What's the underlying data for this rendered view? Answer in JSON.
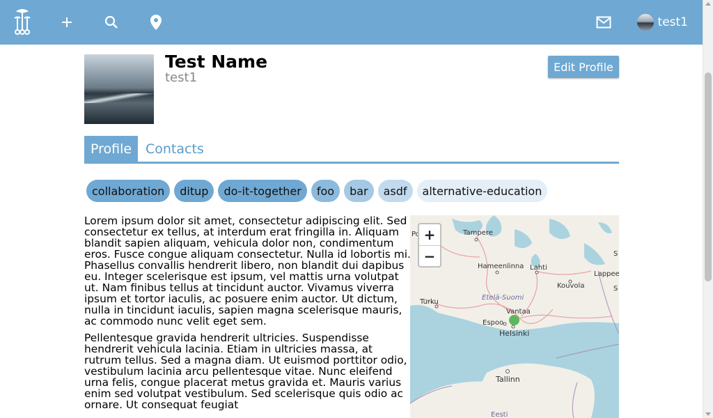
{
  "topbar": {
    "icons": [
      "mushroom-logo-icon",
      "plus-icon",
      "search-icon",
      "location-pin-icon",
      "mail-icon"
    ],
    "username": "test1",
    "color": "#6fa8d2"
  },
  "profile": {
    "name": "Test Name",
    "username": "test1",
    "edit_label": "Edit Profile"
  },
  "tabs": {
    "profile": "Profile",
    "contacts": "Contacts"
  },
  "tags": [
    {
      "label": "collaboration",
      "color": "#6fa8d2"
    },
    {
      "label": "ditup",
      "color": "#6fa8d2"
    },
    {
      "label": "do-it-together",
      "color": "#6fa8d2"
    },
    {
      "label": "foo",
      "color": "#8bbadc"
    },
    {
      "label": "bar",
      "color": "#a5c9e4"
    },
    {
      "label": "asdf",
      "color": "#c2daee"
    },
    {
      "label": "alternative-education",
      "color": "#e4eef7"
    }
  ],
  "bio": {
    "p1": "Lorem ipsum dolor sit amet, consectetur adipiscing elit. Sed consectetur ex tellus, at interdum erat fringilla in. Aliquam blandit sapien aliquam, vehicula dolor non, condimentum eros. Fusce congue aliquam consectetur. Nulla id lobortis mi. Phasellus convallis hendrerit libero, non blandit dui dapibus eu. Integer scelerisque est ipsum, vel mattis urna volutpat ut. Nam finibus tellus at tincidunt auctor. Vivamus viverra ipsum et tortor iaculis, ac posuere enim auctor. Ut dictum, nulla in tincidunt iaculis, sapien magna scelerisque mauris, ac commodo nunc velit eget sem.",
    "p2": "Pellentesque gravida hendrerit ultricies. Suspendisse hendrerit vehicula lacinia. Etiam in ultricies massa, at rutrum tellus. Sed a magna diam. Ut euismod porttitor odio, vestibulum lacinia arcu pellentesque vitae. Nunc eleifend urna felis, congue placerat metus gravida et. Mauris varius enim sed volutpat vestibulum. Sed scelerisque quis odio ac ornare. Ut consequat feugiat"
  },
  "map": {
    "zoom_in": "+",
    "zoom_out": "−",
    "labels": {
      "tampere": "Tampere",
      "hameenlinna": "Hameenlinna",
      "lahti": "Lahti",
      "kouvola": "Kouvola",
      "lappee": "Lappee",
      "turku": "Turku",
      "etela_suomi": "Etelä-Suomi",
      "vantaa": "Vantaa",
      "espoo": "Espoo",
      "helsinki": "Helsinki",
      "tallinn": "Tallinn",
      "eesti": "Eesti",
      "por": "Por",
      "s1": "S",
      "s2": "S"
    },
    "marker_color": "#5cb85c"
  }
}
